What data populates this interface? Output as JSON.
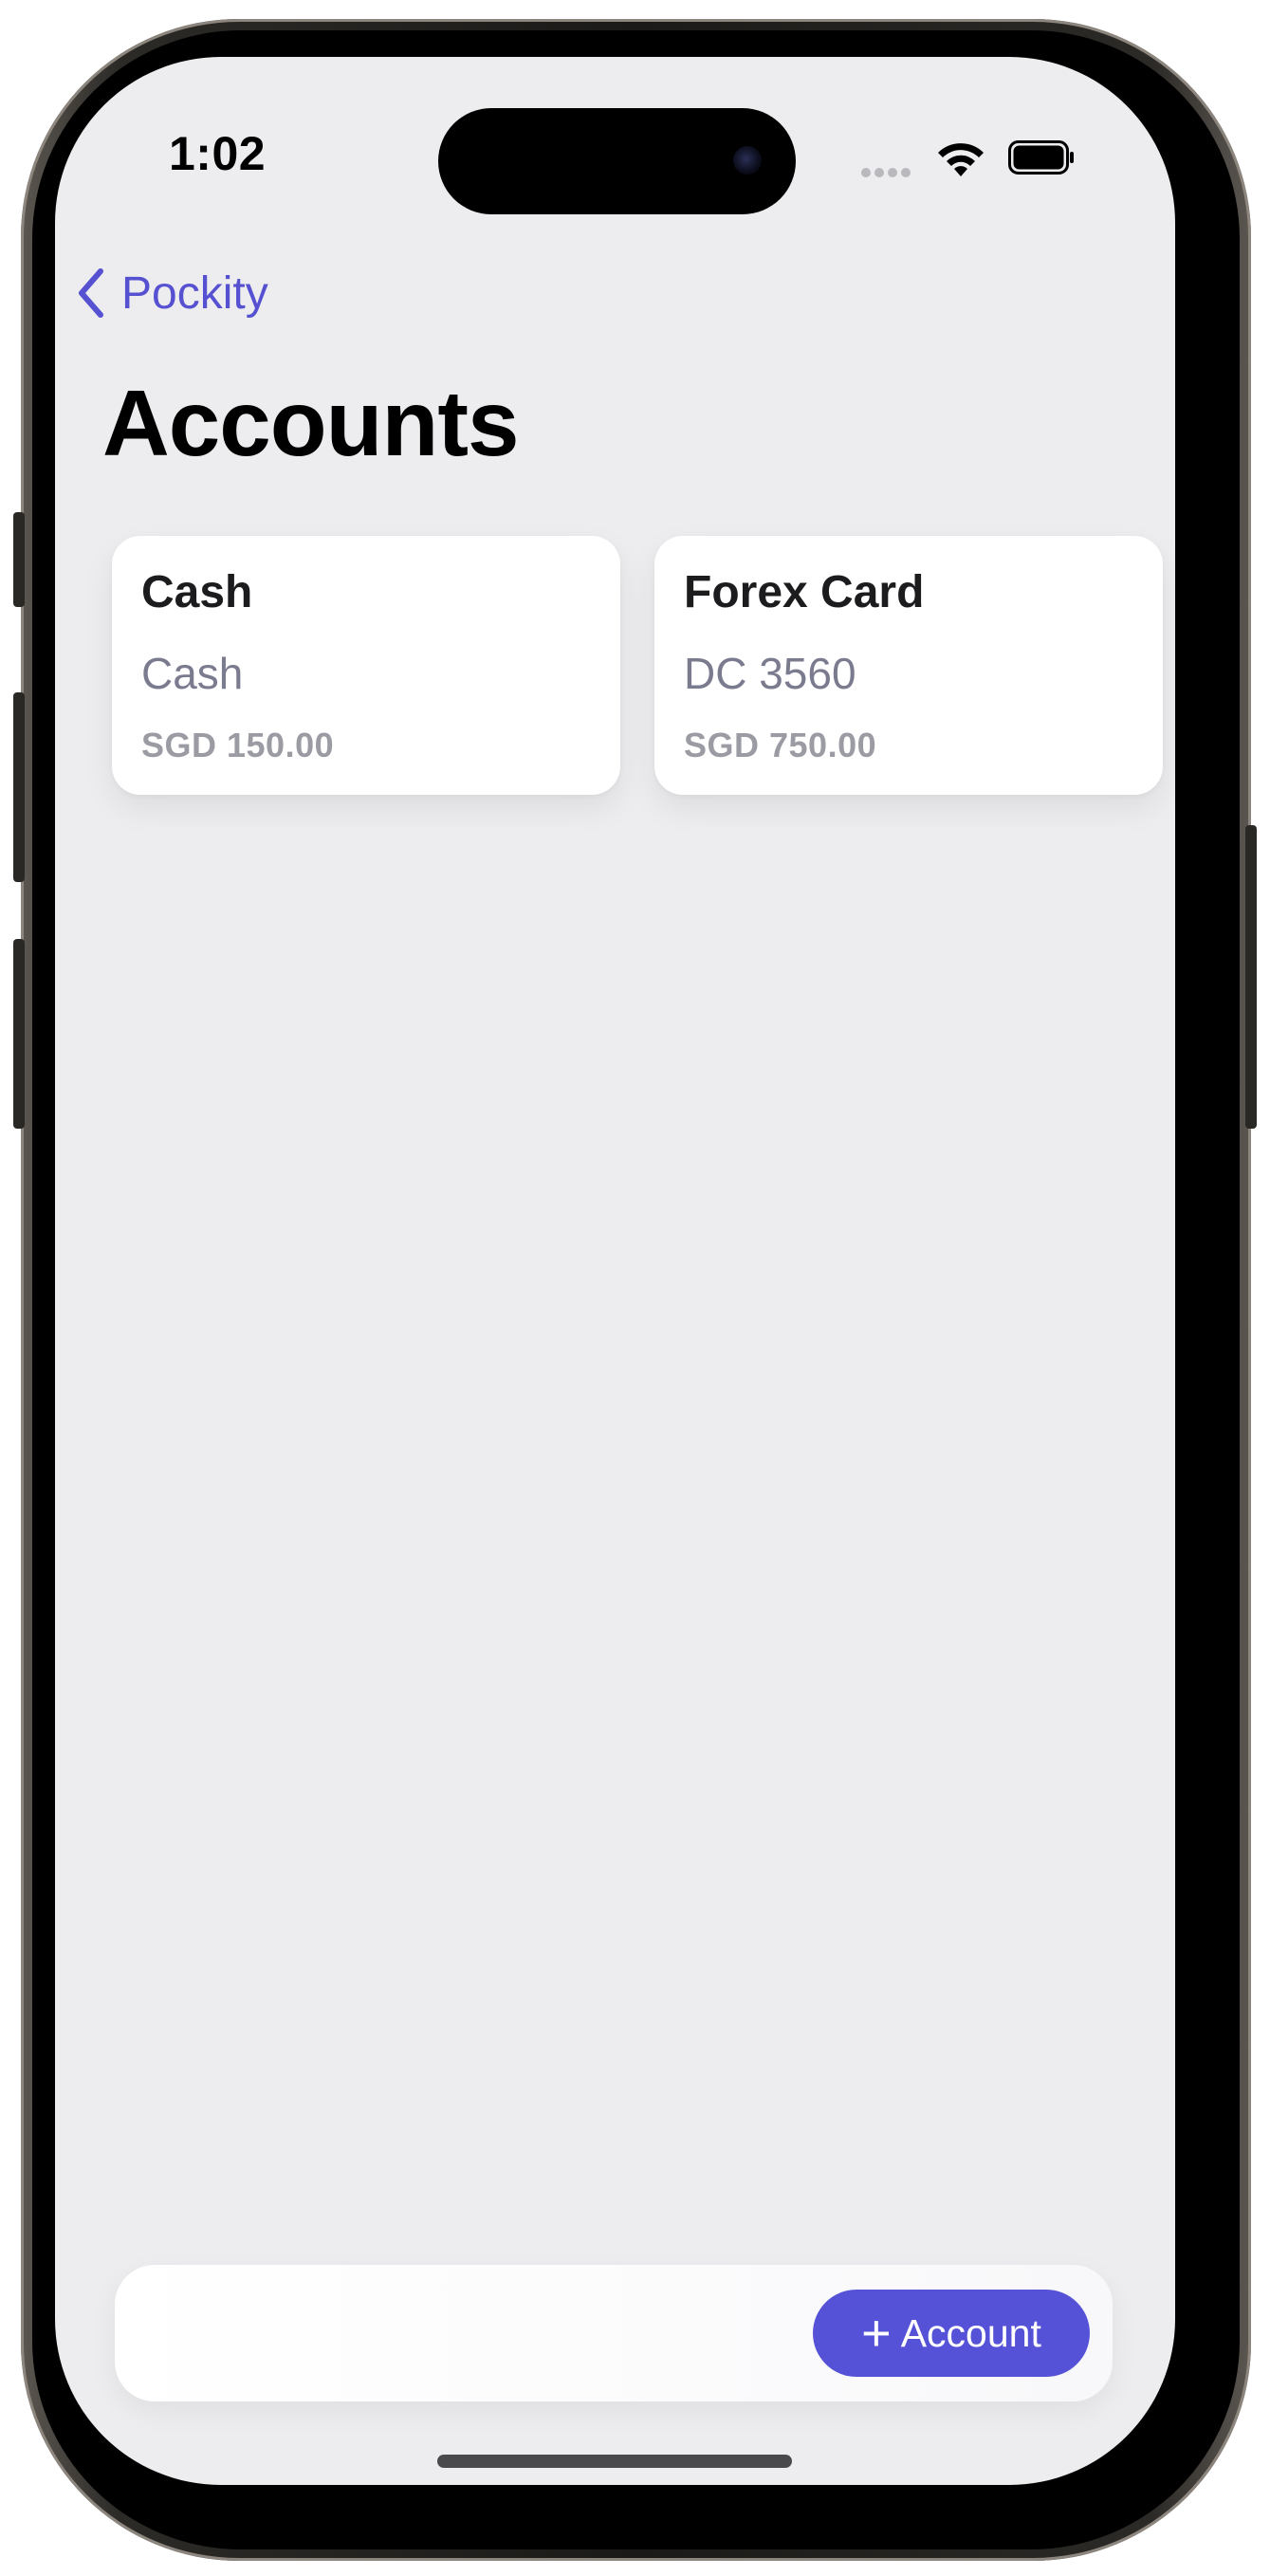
{
  "status_bar": {
    "time": "1:02",
    "icons": [
      "cellular-dots-icon",
      "wifi-icon",
      "battery-icon"
    ]
  },
  "nav": {
    "back_label": "Pockity",
    "back_icon": "chevron-left-icon"
  },
  "page": {
    "title": "Accounts"
  },
  "accounts": [
    {
      "name": "Cash",
      "type": "Cash",
      "balance": "SGD 150.00"
    },
    {
      "name": "Forex Card",
      "type": "DC 3560",
      "balance": "SGD 750.00"
    }
  ],
  "toolbar": {
    "add_label": "Account",
    "add_icon": "plus-icon"
  },
  "colors": {
    "accent": "#5652D8",
    "background": "#EDEDF0",
    "card": "#FFFFFF",
    "secondary_text": "#7B7B8F"
  }
}
